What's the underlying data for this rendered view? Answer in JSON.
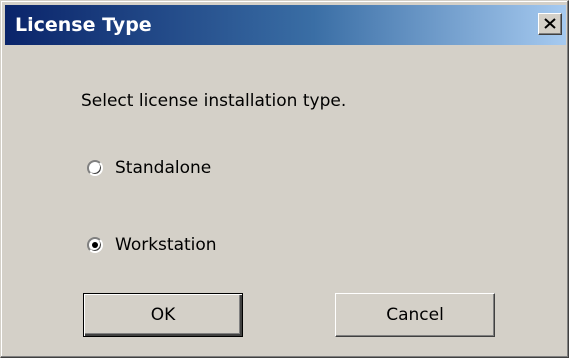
{
  "dialog": {
    "title": "License Type",
    "close_label": "×",
    "prompt": "Select license installation type.",
    "options": [
      {
        "label": "Standalone",
        "selected": false
      },
      {
        "label": "Workstation",
        "selected": true
      }
    ],
    "buttons": {
      "ok": "OK",
      "cancel": "Cancel"
    }
  },
  "colors": {
    "dialog_bg": "#d4d0c8",
    "titlebar_start": "#0a246a",
    "titlebar_end": "#a6caf0",
    "title_text": "#ffffff"
  },
  "icons": {
    "close": "close-icon",
    "radio": "radio-button-icon"
  }
}
